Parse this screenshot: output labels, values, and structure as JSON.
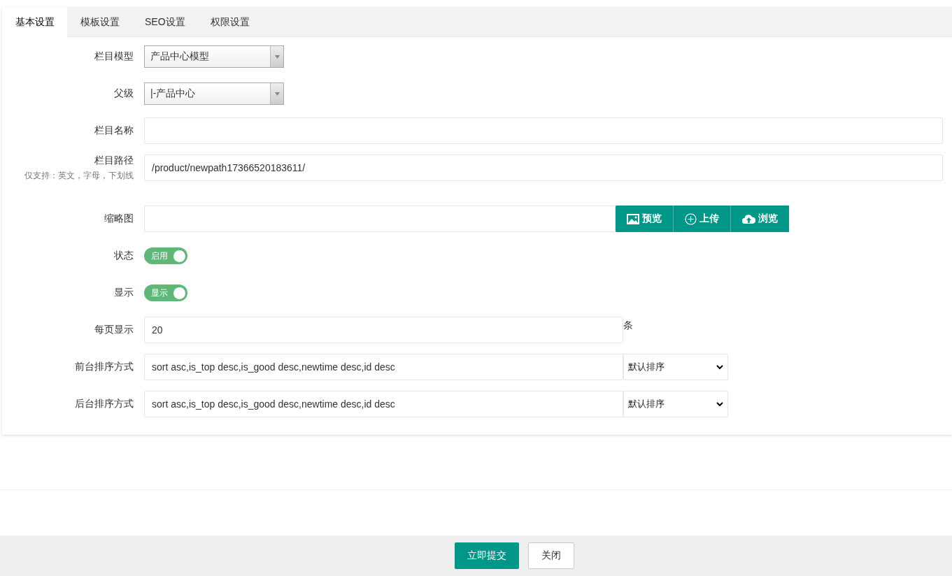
{
  "tabs": [
    {
      "label": "基本设置",
      "selected": true
    },
    {
      "label": "模板设置",
      "selected": false
    },
    {
      "label": "SEO设置",
      "selected": false
    },
    {
      "label": "权限设置",
      "selected": false
    }
  ],
  "fields": [
    {
      "kind": "select",
      "label": "栏目模型",
      "value": "产品中心模型"
    },
    {
      "kind": "select",
      "label": "父级",
      "value": "|-产品中心"
    },
    {
      "kind": "text",
      "label": "栏目名称"
    },
    {
      "kind": "text",
      "label": "栏目路径",
      "hint": "仅支持：英文，字母，下划线",
      "value": "/product/newpath17366520183611/"
    },
    {
      "kind": "thumbnail",
      "label": "缩略图",
      "buttons": [
        "预览",
        "上传",
        "浏览"
      ]
    },
    {
      "kind": "switch",
      "label": "状态",
      "text": "启用",
      "on": true
    },
    {
      "kind": "switch",
      "label": "显示",
      "text": "显示",
      "on": true
    },
    {
      "kind": "unit",
      "label": "每页显示",
      "value": "20",
      "unit": "条"
    },
    {
      "kind": "sort",
      "label": "前台排序方式",
      "value": "sort asc,is_top desc,is_good desc,newtime desc,id desc",
      "option": "默认排序"
    },
    {
      "kind": "sort",
      "label": "后台排序方式",
      "value": "sort asc,is_top desc,is_good desc,newtime desc,id desc",
      "option": "默认排序"
    }
  ],
  "footer": {
    "submit": "立即提交",
    "close": "关闭"
  }
}
